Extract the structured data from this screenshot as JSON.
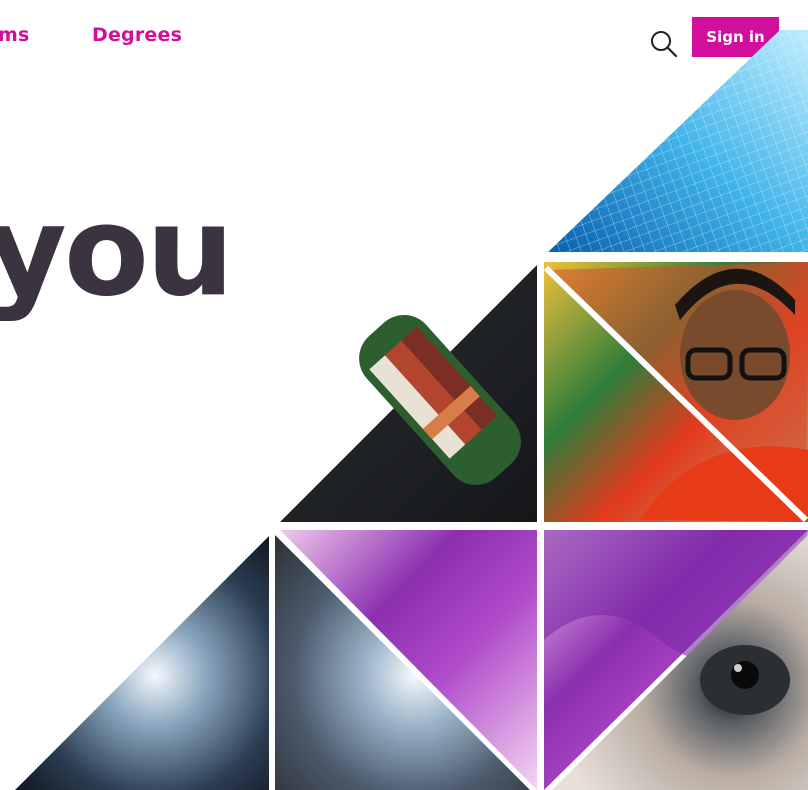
{
  "nav": {
    "items": [
      {
        "label": "ms"
      },
      {
        "label": "Degrees"
      }
    ],
    "sign_in_label": "Sign in"
  },
  "hero": {
    "headline_fragment": "you"
  },
  "colors": {
    "brand": "#d10f9c",
    "headline": "#3b3340",
    "background": "#ffffff"
  },
  "icons": {
    "search": "search-icon"
  },
  "collage_tiles": [
    "wireframe-face-tile",
    "cargo-ship-tile",
    "student-portrait-tile",
    "earth-from-space-tile",
    "histology-tile",
    "eye-closeup-tile"
  ]
}
